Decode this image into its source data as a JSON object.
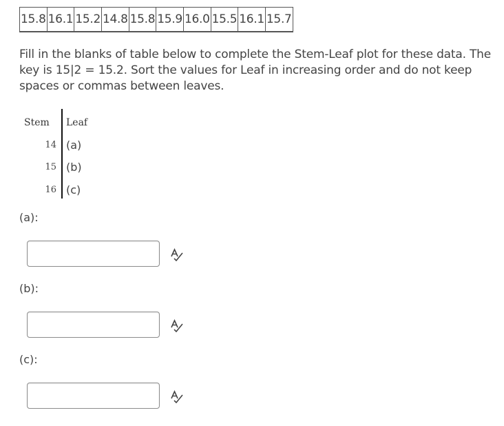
{
  "data_values": [
    "15.8",
    "16.1",
    "15.2",
    "14.8",
    "15.8",
    "15.9",
    "16.0",
    "15.5",
    "16.1",
    "15.7"
  ],
  "instructions": "Fill in the blanks of table below to complete the Stem-Leaf plot for these data. The key is 15|2 = 15.2. Sort the values for Leaf in increasing order and do not keep spaces or commas between leaves.",
  "stem_leaf": {
    "header_stem": "Stem",
    "header_leaf": "Leaf",
    "rows": [
      {
        "stem": "14",
        "leaf": "(a)"
      },
      {
        "stem": "15",
        "leaf": "(b)"
      },
      {
        "stem": "16",
        "leaf": "(c)"
      }
    ]
  },
  "answers": [
    {
      "label": "(a):",
      "value": "",
      "placeholder": ""
    },
    {
      "label": "(b):",
      "value": "",
      "placeholder": ""
    },
    {
      "label": "(c):",
      "value": "",
      "placeholder": ""
    }
  ],
  "icons": {
    "spell_check": "spell-check-icon"
  }
}
